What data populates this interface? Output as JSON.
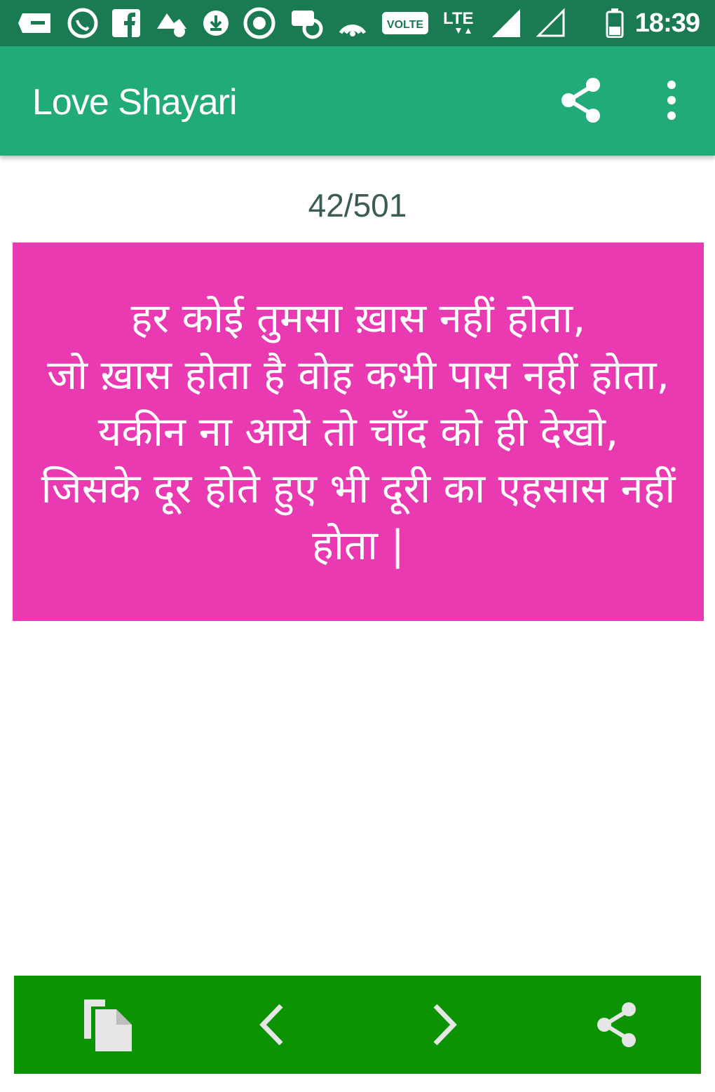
{
  "status_bar": {
    "time": "18:39",
    "volte_label": "VOLTE",
    "lte_label": "LTE",
    "icons": [
      "message-icon",
      "whatsapp-icon",
      "facebook-icon",
      "notification-icon",
      "download-icon",
      "vpn-icon",
      "app-icon",
      "hotspot-icon",
      "volte-icon",
      "lte-icon",
      "signal-icon",
      "signal-empty-icon",
      "battery-icon"
    ]
  },
  "app_bar": {
    "title": "Love Shayari",
    "share_icon": "share-icon",
    "menu_icon": "more-vertical-icon"
  },
  "counter": "42/501",
  "shayari": {
    "text": "हर कोई तुमसा ख़ास नहीं होता,\nजो ख़ास होता है वोह कभी पास नहीं होता,\nयकीन ना आये तो चाँद को ही देखो,\nजिसके दूर होते हुए भी दूरी का एहसास नहीं होता |",
    "background": "#e93ab2",
    "text_color": "#ffffff"
  },
  "bottom_bar": {
    "background": "#0b9302",
    "buttons": [
      "copy-icon",
      "chevron-left-icon",
      "chevron-right-icon",
      "share-icon"
    ]
  },
  "colors": {
    "status_bar": "#1a7a52",
    "app_bar": "#21ab78",
    "counter_text": "#3b5d50"
  }
}
